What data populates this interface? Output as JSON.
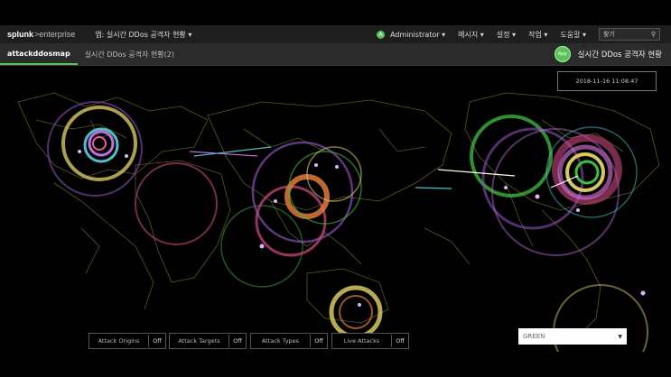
{
  "topbar": {
    "logo": "splunk",
    "logo_suffix": ">enterprise",
    "app_menu": "앱: 실시간 DDos 공격자 현황 ▾",
    "user_initial": "A",
    "user": "Administrator ▾",
    "menu_messages": "메시지 ▾",
    "menu_settings": "설정 ▾",
    "menu_activity": "작업 ▾",
    "menu_help": "도움말 ▾",
    "search_placeholder": "찾기"
  },
  "subbar": {
    "tabs": [
      {
        "label": "attackddosmap"
      },
      {
        "label": "실시간 DDos 공격자 현황(2)"
      }
    ],
    "badge": "App",
    "dashboard_title": "실시간 DDos 공격자 현황"
  },
  "map": {
    "timestamp": "2018-11-16 11:08:47"
  },
  "controls": {
    "toggles": [
      {
        "label": "Attack Origins",
        "state": "Off"
      },
      {
        "label": "Attack Targets",
        "state": "Off"
      },
      {
        "label": "Attack Types",
        "state": "Off"
      },
      {
        "label": "Live Attacks",
        "state": "Off"
      }
    ],
    "color_select": "GREEN"
  },
  "colors": {
    "accent": "#5cc05c",
    "ring_yellow": "#d8c860",
    "ring_purple": "#8a4fb8",
    "ring_green": "#3fc040",
    "ring_orange": "#e07a3a",
    "ring_pink": "#c84880",
    "ring_cyan": "#4fc0c8"
  }
}
